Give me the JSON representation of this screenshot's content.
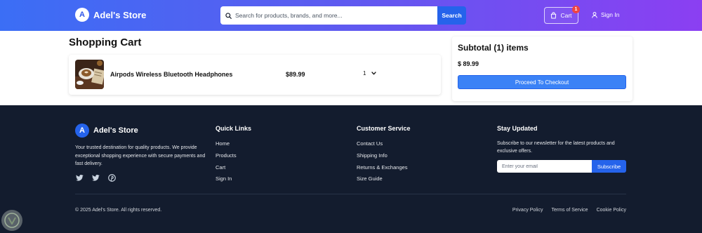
{
  "header": {
    "brand_initial": "A",
    "brand_name": "Adel's Store",
    "search_placeholder": "Search for products, brands, and more...",
    "search_button": "Search",
    "cart_label": "Cart",
    "cart_count": "1",
    "signin_label": "Sign In"
  },
  "cart": {
    "title": "Shopping Cart",
    "items": [
      {
        "name": "Airpods Wireless Bluetooth Headphones",
        "price": "$89.99",
        "quantity": "1"
      }
    ]
  },
  "summary": {
    "title": "Subtotal (1) items",
    "amount": "$ 89.99",
    "checkout_label": "Proceed To Checkout"
  },
  "footer": {
    "brand_initial": "A",
    "brand_name": "Adel's Store",
    "description": "Your trusted destination for quality products. We provide exceptional shopping experience with secure payments and fast delivery.",
    "socials": [
      "twitter-icon",
      "twitter-icon",
      "pinterest-icon"
    ],
    "quick_links": {
      "title": "Quick Links",
      "items": [
        "Home",
        "Products",
        "Cart",
        "Sign In"
      ]
    },
    "customer_service": {
      "title": "Customer Service",
      "items": [
        "Contact Us",
        "Shipping Info",
        "Returns & Exchanges",
        "Size Guide"
      ]
    },
    "newsletter": {
      "title": "Stay Updated",
      "description": "Subscribe to our newsletter for the latest products and exclusive offers.",
      "email_placeholder": "Enter your email",
      "subscribe_label": "Subscribe"
    },
    "copyright": "© 2025 Adel's Store. All rights reserved.",
    "legal": [
      "Privacy Policy",
      "Terms of Service",
      "Cookie Policy"
    ]
  },
  "colors": {
    "header_gradient_start": "#3b6ef5",
    "header_gradient_end": "#8b3ff2",
    "primary": "#2563eb",
    "checkout": "#3b82f6",
    "badge": "#ef4444",
    "footer_bg": "#131c2e"
  }
}
